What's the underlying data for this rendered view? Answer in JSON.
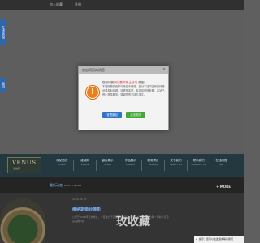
{
  "topbar": {
    "link1": "加入收藏",
    "link2": "注册"
  },
  "side_tabs": {
    "online_service": "在线咨询",
    "back_top": "返回"
  },
  "dialog": {
    "title": "来自网页的消息",
    "headline_prefix": "您访问的",
    "headline_emphasis": "网站暂时停止访问",
    "headline_suffix": " 原因",
    "body": "本站所提供资料均来自于网络，如对本站内容有任何疑问或权利问题，请联系本站，本站将尽快处理。本站已停止提供服务，感谢您的支持与关注。",
    "buttons": {
      "left": "查看原因",
      "right": "点击关闭"
    },
    "colors": {
      "orange": "#ef7d1a",
      "blue": "#2f74c9",
      "green": "#42a93a"
    }
  },
  "brand": {
    "logo_text": "VENUS",
    "logo_subtitle": "维纳斯"
  },
  "nav": [
    {
      "cn": "网站首页",
      "en": "HOME"
    },
    {
      "cn": "维纳斯",
      "en": "VENUS"
    },
    {
      "cn": "客片展示",
      "en": "SHOW"
    },
    {
      "cn": "作品展示",
      "en": "WORKS"
    },
    {
      "cn": "服务项目",
      "en": "SERVICE"
    },
    {
      "cn": "关于我们",
      "en": "ABOUT US"
    },
    {
      "cn": "联系我们",
      "en": "CONTACT US"
    },
    {
      "cn": "在线问答",
      "en": "FAQ"
    }
  ],
  "news": {
    "title": "最新动态",
    "subtitle": "LATEST NEWS",
    "more": "+ MORE"
  },
  "item": {
    "date": "2016-08-10",
    "title": "维纳斯婚纱摄影",
    "desc": "公司于2016年正式成立，一直致力于高端婚纱摄影，服务于广大新人，为每一对新人打造完美婚纱照"
  },
  "watermark": "玫收藏",
  "float_box": "提示：您可以在此留言联系我们"
}
